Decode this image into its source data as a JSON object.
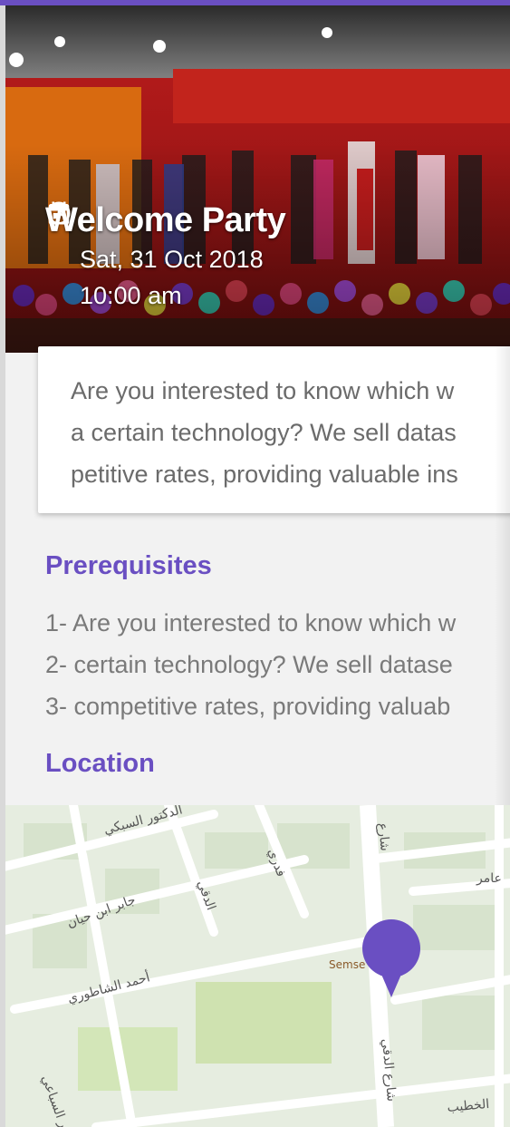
{
  "event": {
    "title": "Welcome Party",
    "date": "Sat, 31 Oct 2018",
    "time": "10:00 am"
  },
  "description": {
    "lines": [
      "Are you interested to know which w",
      "a certain technology? We sell datas",
      "petitive rates, providing valuable ins"
    ]
  },
  "prerequisites": {
    "heading": "Prerequisites",
    "items": [
      "1- Are you interested to know which w",
      "2- certain technology? We sell datase",
      "3- competitive rates, providing valuab"
    ]
  },
  "location": {
    "heading": "Location"
  },
  "map": {
    "labels": [
      "الدكتور السبكي",
      "جابر ابن حيان",
      "أحمد الشاطوري",
      "الدكتور السباعي",
      "فدري",
      "الدقي",
      "شارع",
      "عامر",
      "شارع الدقي",
      "الخطيب",
      "Semse"
    ]
  },
  "colors": {
    "accent": "#6a4fc2",
    "pin": "#6a4fc2"
  }
}
